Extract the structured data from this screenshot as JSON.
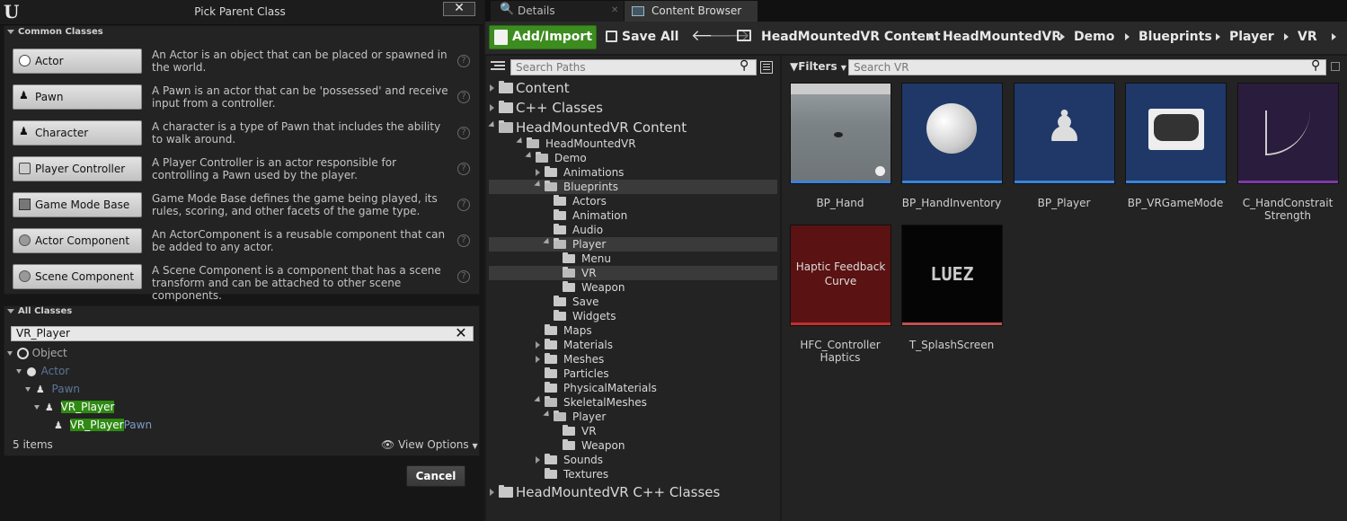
{
  "dialog": {
    "title": "Pick Parent Class",
    "close_label": "✕",
    "common_header": "Common Classes",
    "common_classes": [
      {
        "label": "Actor",
        "desc": "An Actor is an object that can be placed or spawned in the world."
      },
      {
        "label": "Pawn",
        "desc": "A Pawn is an actor that can be 'possessed' and receive input from a controller."
      },
      {
        "label": "Character",
        "desc": "A character is a type of Pawn that includes the ability to walk around."
      },
      {
        "label": "Player Controller",
        "desc": "A Player Controller is an actor responsible for controlling a Pawn used by the player."
      },
      {
        "label": "Game Mode Base",
        "desc": "Game Mode Base defines the game being played, its rules, scoring, and other facets of the game type."
      },
      {
        "label": "Actor Component",
        "desc": "An ActorComponent is a reusable component that can be added to any actor."
      },
      {
        "label": "Scene Component",
        "desc": "A Scene Component is a component that has a scene transform and can be attached to other scene components."
      }
    ],
    "help_glyph": "?",
    "all_header": "All Classes",
    "search_value": "VR_Player",
    "tree": {
      "object": "Object",
      "actor": "Actor",
      "pawn": "Pawn",
      "vr_player": "VR_Player",
      "vr_playerpawn_hl": "VR_Player",
      "vr_playerpawn_rest": "Pawn"
    },
    "item_count": "5 items",
    "view_options": "View Options",
    "cancel": "Cancel"
  },
  "tabs": [
    {
      "label": "Details"
    },
    {
      "label": "Content Browser"
    }
  ],
  "toolbar": {
    "add_import": "Add/Import",
    "save_all": "Save All",
    "breadcrumbs": [
      "HeadMountedVR Content",
      "HeadMountedVR",
      "Demo",
      "Blueprints",
      "Player",
      "VR"
    ]
  },
  "paths": {
    "search_placeholder": "Search Paths",
    "items": {
      "content": "Content",
      "cpp": "C++ Classes",
      "hmvr_content": "HeadMountedVR Content",
      "hmvr": "HeadMountedVR",
      "demo": "Demo",
      "animations": "Animations",
      "blueprints": "Blueprints",
      "actors": "Actors",
      "animation": "Animation",
      "audio": "Audio",
      "player": "Player",
      "menu": "Menu",
      "vr": "VR",
      "weapon": "Weapon",
      "save": "Save",
      "widgets": "Widgets",
      "maps": "Maps",
      "materials": "Materials",
      "meshes": "Meshes",
      "particles": "Particles",
      "physmat": "PhysicalMaterials",
      "skeletal": "SkeletalMeshes",
      "sk_player": "Player",
      "sk_vr": "VR",
      "sk_weapon": "Weapon",
      "sounds": "Sounds",
      "textures": "Textures",
      "hmvr_cpp": "HeadMountedVR C++ Classes"
    }
  },
  "assets": {
    "filters": "Filters",
    "search_placeholder": "Search VR",
    "items": [
      {
        "name": "BP_Hand"
      },
      {
        "name": "BP_HandInventory"
      },
      {
        "name": "BP_Player"
      },
      {
        "name": "BP_VRGameMode"
      },
      {
        "name": "C_HandConstrait Strength"
      },
      {
        "name": "HFC_Controller Haptics",
        "thumb_text": "Haptic Feedback Curve"
      },
      {
        "name": "T_SplashScreen",
        "thumb_text": "LUEZ"
      }
    ]
  },
  "colors": {
    "accent_green": "#3c8c1f",
    "blueprint_bar": "#3a82d8",
    "selection": "#3a3a3a"
  }
}
